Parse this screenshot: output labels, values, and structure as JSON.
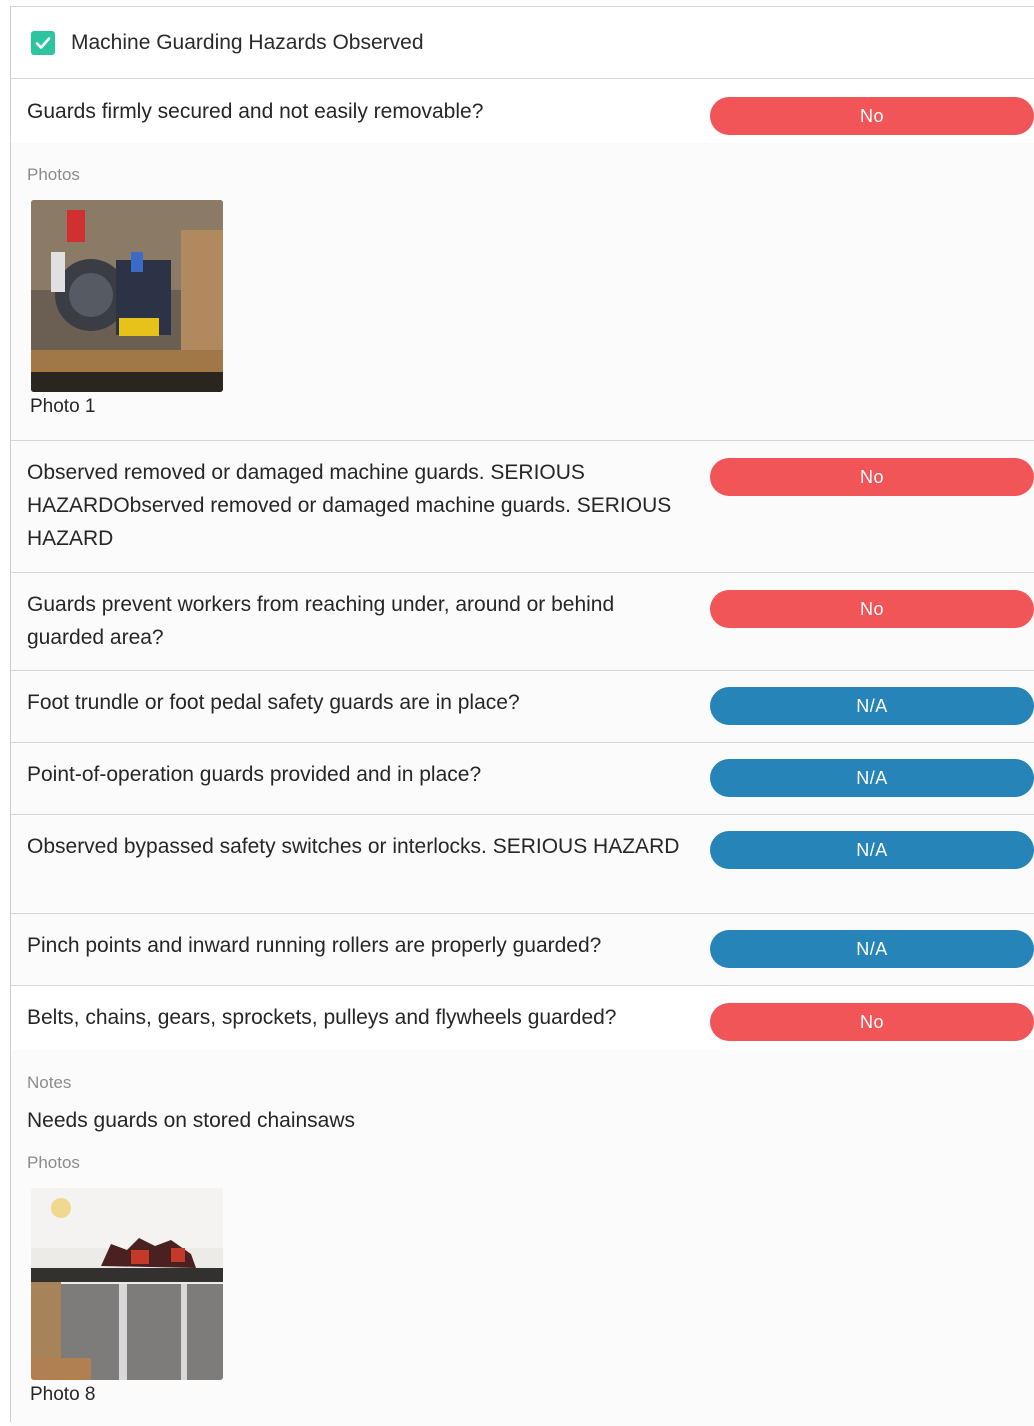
{
  "section": {
    "title": "Machine Guarding Hazards Observed",
    "checked": true
  },
  "colors": {
    "no": "#f25558",
    "na": "#2684b8",
    "check": "#2ec4a0"
  },
  "items": [
    {
      "question": "Guards firmly secured and not easily removable?",
      "answer": "No",
      "photos_label": "Photos",
      "photo_caption": "Photo 1"
    },
    {
      "question": "Observed removed or damaged machine guards. SERIOUS HAZARDObserved removed or damaged machine guards. SERIOUS HAZARD",
      "answer": "No"
    },
    {
      "question": "Guards prevent workers from reaching under, around or behind guarded area?",
      "answer": "No"
    },
    {
      "question": "Foot trundle or foot pedal safety guards are in place?",
      "answer": "N/A"
    },
    {
      "question": "Point-of-operation guards provided and in place?",
      "answer": "N/A"
    },
    {
      "question": "Observed bypassed safety switches or interlocks. SERIOUS HAZARD",
      "answer": "N/A"
    },
    {
      "question": "Pinch points and inward running rollers are properly guarded?",
      "answer": "N/A"
    },
    {
      "question": "Belts, chains, gears, sprockets, pulleys and flywheels guarded?",
      "answer": "No",
      "notes_label": "Notes",
      "notes_text": "Needs guards on stored chainsaws",
      "photos_label": "Photos",
      "photo_caption": "Photo 8"
    }
  ]
}
